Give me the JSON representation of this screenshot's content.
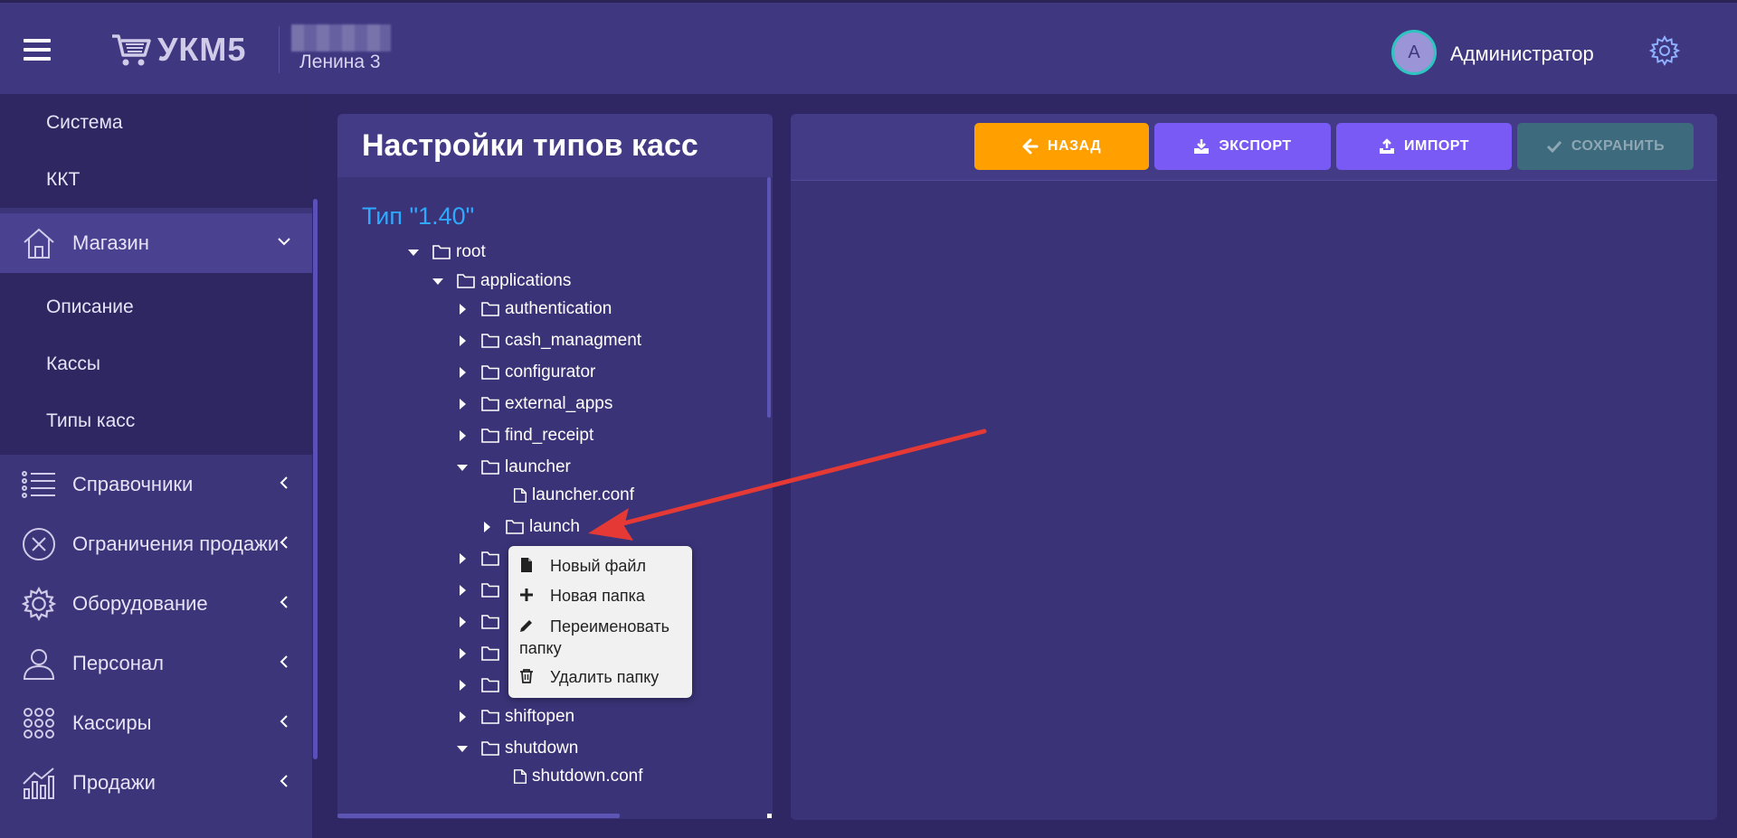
{
  "header": {
    "app_name": "УКМ5",
    "shop_name": "Ленина 3",
    "avatar_letter": "А",
    "username": "Администратор"
  },
  "sidebar": {
    "top_items": [
      "Система",
      "ККТ"
    ],
    "store": {
      "label": "Магазин"
    },
    "store_subitems": [
      "Описание",
      "Кассы",
      "Типы касс"
    ],
    "items": [
      {
        "label": "Справочники",
        "icon": "list-icon"
      },
      {
        "label": "Ограничения продажи",
        "icon": "circle-x-icon"
      },
      {
        "label": "Оборудование",
        "icon": "gear-icon"
      },
      {
        "label": "Персонал",
        "icon": "person-icon"
      },
      {
        "label": "Кассиры",
        "icon": "grid-dots-icon"
      },
      {
        "label": "Продажи",
        "icon": "bar-chart-icon"
      }
    ]
  },
  "left_panel": {
    "title": "Настройки типов касс",
    "type_label": "Тип \"1.40\"",
    "tree": [
      {
        "label": "root",
        "kind": "folder",
        "expanded": true
      },
      {
        "label": "applications",
        "kind": "folder",
        "expanded": true
      },
      {
        "label": "authentication",
        "kind": "folder"
      },
      {
        "label": "cash_managment",
        "kind": "folder"
      },
      {
        "label": "configurator",
        "kind": "folder"
      },
      {
        "label": "external_apps",
        "kind": "folder"
      },
      {
        "label": "find_receipt",
        "kind": "folder"
      },
      {
        "label": "launcher",
        "kind": "folder",
        "expanded": true
      },
      {
        "label": "launcher.conf",
        "kind": "file"
      },
      {
        "label": "launch",
        "kind": "folder"
      },
      {
        "label": "shiftopen",
        "kind": "folder"
      },
      {
        "label": "shutdown",
        "kind": "folder",
        "expanded": true
      },
      {
        "label": "shutdown.conf",
        "kind": "file"
      }
    ]
  },
  "toolbar": {
    "back": "НАЗАД",
    "export": "ЭКСПОРТ",
    "import": "ИМПОРТ",
    "save": "СОХРАНИТЬ"
  },
  "context_menu": {
    "new_file": "Новый файл",
    "new_folder": "Новая папка",
    "rename_line1": "Переименовать",
    "rename_line2": "папку",
    "delete_folder": "Удалить папку"
  },
  "colors": {
    "header": "#3f3780",
    "background": "#2f2763",
    "accent_orange": "#ffa000",
    "accent_purple": "#7a5af5",
    "link_blue": "#2fa9ff",
    "annotation_red": "#e53935"
  }
}
